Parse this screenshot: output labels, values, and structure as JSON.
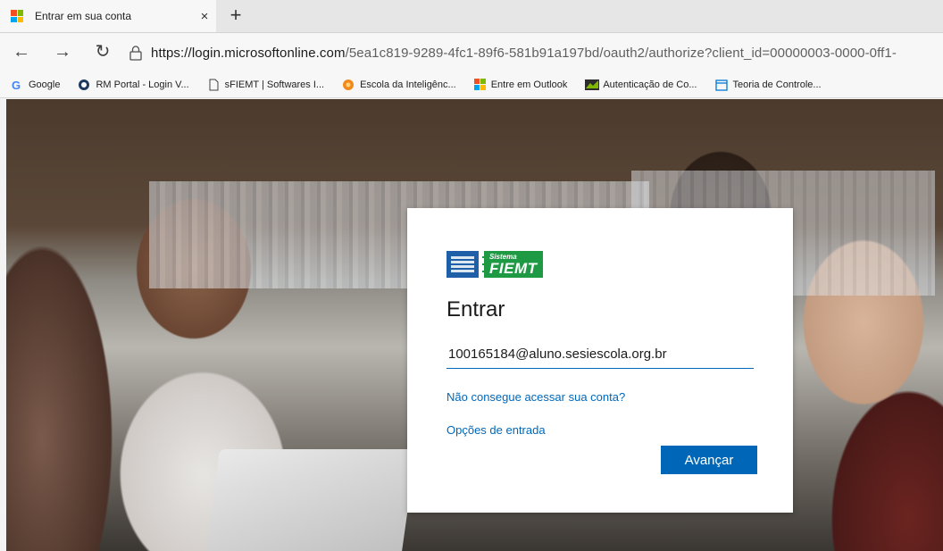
{
  "browser": {
    "tab": {
      "title": "Entrar em sua conta",
      "close": "×"
    },
    "new_tab": "+",
    "nav": {
      "back": "←",
      "forward": "→",
      "refresh": "↻"
    },
    "address": {
      "host": "https://login.microsoftonline.com",
      "path": "/5ea1c819-9289-4fc1-89f6-581b91a197bd/oauth2/authorize?client_id=00000003-0000-0ff1-"
    },
    "bookmarks": [
      {
        "label": "Google",
        "icon": "google-icon"
      },
      {
        "label": "RM Portal - Login V...",
        "icon": "rm-portal-icon"
      },
      {
        "label": "sFIEMT | Softwares I...",
        "icon": "page-icon"
      },
      {
        "label": "Escola da Inteligênc...",
        "icon": "escola-icon"
      },
      {
        "label": "Entre em Outlook",
        "icon": "microsoft-logo-icon"
      },
      {
        "label": "Autenticação de Co...",
        "icon": "autenticacao-icon"
      },
      {
        "label": "Teoria de Controle...",
        "icon": "calendar-icon"
      }
    ]
  },
  "login": {
    "logo": {
      "left_text": "FIESP SESI SENAI IEL",
      "line1": "Sistema",
      "line2": "FIEMT"
    },
    "title": "Entrar",
    "email_value": "100165184@aluno.sesiescola.org.br",
    "cant_access": "Não consegue acessar sua conta?",
    "sign_in_options": "Opções de entrada",
    "next_button": "Avançar"
  },
  "colors": {
    "accent": "#0067b8",
    "ms_red": "#f25022",
    "ms_green": "#7fba00",
    "ms_blue": "#00a4ef",
    "ms_yellow": "#ffb900",
    "fiemt_green": "#1f9a44",
    "fiemt_blue": "#1f5fa8"
  }
}
